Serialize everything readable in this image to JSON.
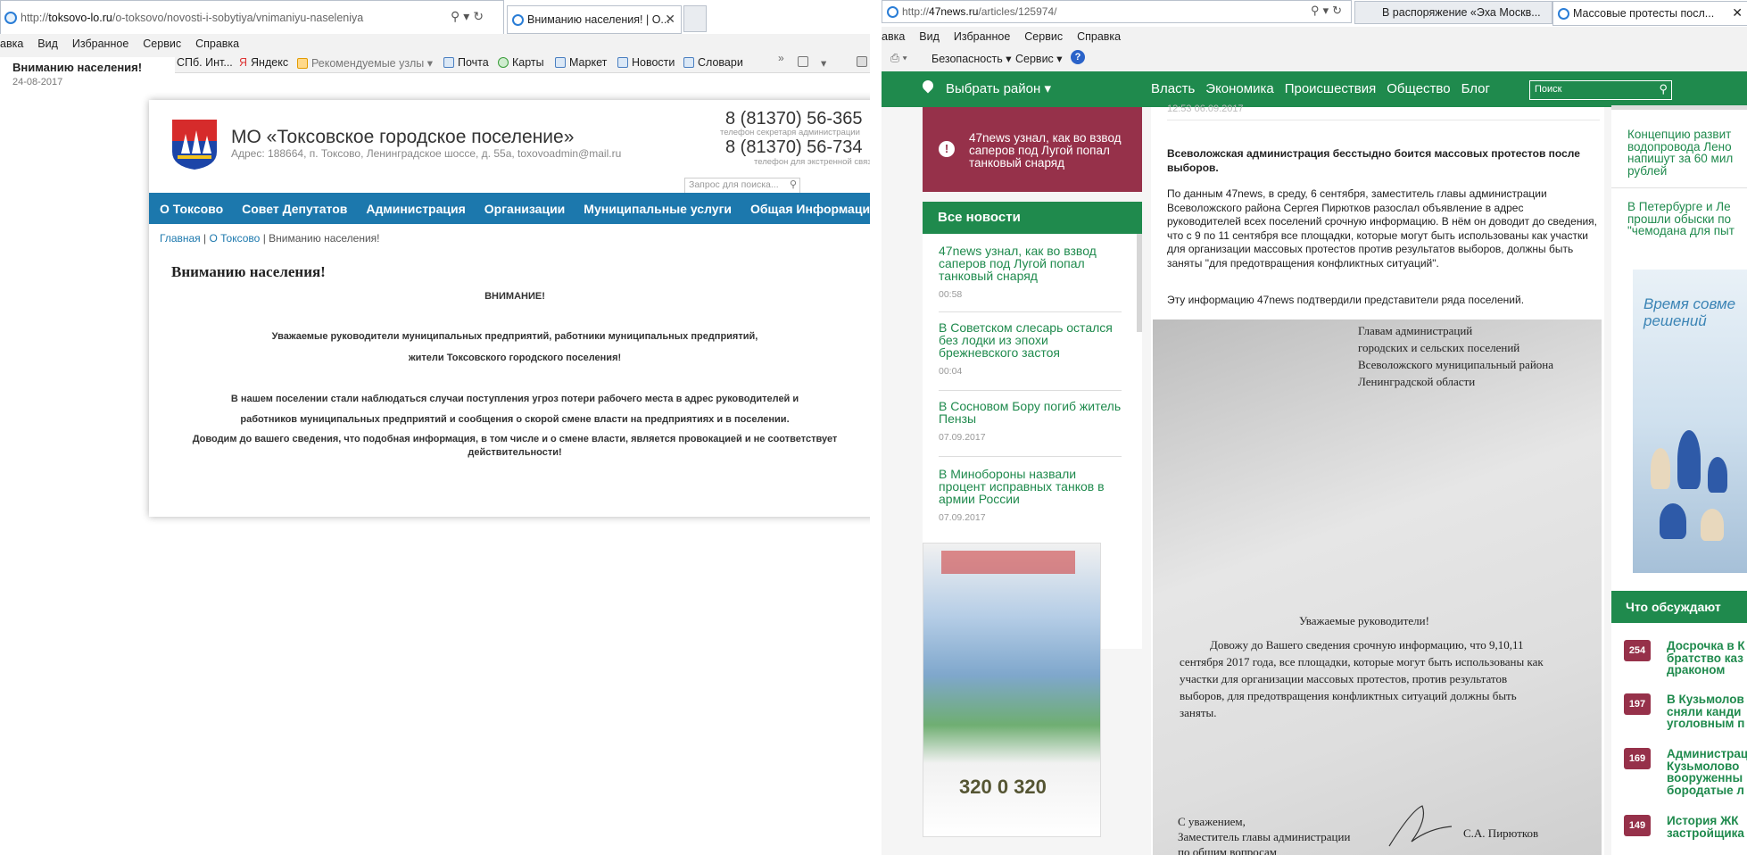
{
  "left": {
    "address_prefix": "http://",
    "address_domain": "toksovo-lo.ru",
    "address_path": "/o-toksovo/novosti-i-sobytiya/vnimaniyu-naseleniya",
    "tab_title": "Вниманию населения! | О...",
    "menu": [
      "авка",
      "Вид",
      "Избранное",
      "Сервис",
      "Справка"
    ],
    "favorites": [
      "СПб. Инт...",
      "Яндекс",
      "Рекомендуемые узлы ▾",
      "Почта",
      "Карты",
      "Маркет",
      "Новости",
      "Словари"
    ],
    "popup_title": "Вниманию населения!",
    "popup_date": "24-08-2017",
    "site_title": "МО «Токсовское городское поселение»",
    "site_address": "Адрес: 188664, п. Токсово, Ленинградское шоссе, д. 55а, toxovoadmin@mail.ru",
    "phone1": "8 (81370) 56-365",
    "phone1_label": "телефон секретаря администрации",
    "phone2": "8 (81370) 56-734",
    "phone2_label": "телефон для экстренной связи",
    "search_placeholder": "Запрос для поиска...",
    "nav": [
      "О Токсово",
      "Совет Депутатов",
      "Администрация",
      "Организации",
      "Муниципальные услуги",
      "Общая Информация"
    ],
    "crumb_home": "Главная",
    "crumb_sep": "|",
    "crumb_section": "О Токсово",
    "crumb_current": "Вниманию населения!",
    "heading": "Вниманию населения!",
    "p_attention": "ВНИМАНИЕ!",
    "p1": "Уважаемые руководители муниципальных предприятий, работники муниципальных предприятий,",
    "p2": "жители Токсовского городского поселения!",
    "p3": "В нашем поселении стали наблюдаться случаи поступления угроз потери рабочего места в адрес руководителей и",
    "p4": "работников муниципальных предприятий и сообщения о  скорой смене  власти на предприятиях и в поселении.",
    "p5": "Доводим до вашего сведения, что подобная  информация, в том числе и о смене власти, является провокацией и не соответствует",
    "p6": "действительности!"
  },
  "right": {
    "address_prefix": "http://",
    "address_domain": "47news.ru",
    "address_path": "/articles/125974/",
    "tab1_title": "В распоряжение «Эха Москв...",
    "tab2_title": "Массовые протесты посл...",
    "menu": [
      "авка",
      "Вид",
      "Избранное",
      "Сервис",
      "Справка"
    ],
    "cmd_safety": "Безопасность ▾",
    "cmd_service": "Сервис ▾",
    "region": "Выбрать район ▾",
    "topnav": [
      "Власть",
      "Экономика",
      "Происшествия",
      "Общество",
      "Блог"
    ],
    "search_placeholder": "Поиск",
    "red_news": "47news узнал, как во взвод саперов под Лугой попал танковый снаряд",
    "all_news": "Все новости",
    "news": [
      {
        "title": "47news узнал, как во взвод саперов под Лугой попал танковый снаряд",
        "time": "00:58"
      },
      {
        "title": "В Советском слесарь остался без лодки из эпохи брежневского застоя",
        "time": "00:04"
      },
      {
        "title": "В Сосновом Бору погиб житель Пензы",
        "time": "07.09.2017"
      },
      {
        "title": "В Минобороны назвали процент исправных танков в армии России",
        "time": "07.09.2017"
      }
    ],
    "ad_text": "320 0 320",
    "article_date": "12:53 06.09.2017",
    "lead": "Всеволожская администрация бесстыдно боится массовых протестов после выборов.",
    "body": "По данным 47news, в среду, 6 сентября, заместитель главы администрации Всеволожского района Сергея Пирютков разослал объявление в адрес руководителей всех поселений срочную информацию. В нём он доводит до сведения, что с 9 по 11 сентября все площадки, которые могут быть использованы как участки для организации массовых протестов против результатов выборов, должны быть заняты \"для предотвращения конфликтных ситуаций\".",
    "confirm": "Эту информацию 47news подтвердили представители ряда поселений.",
    "doc_addr1": "Главам администраций",
    "doc_addr2": "городских и сельских поселений",
    "doc_addr3": "Всеволожского муниципальный района",
    "doc_addr4": "Ленинградской области",
    "doc_greeting": "Уважаемые руководители!",
    "doc_l1": "Довожу до Вашего сведения срочную информацию, что 9,10,11",
    "doc_l2": "сентября 2017 года, все площадки, которые могут быть использованы как",
    "doc_l3": "участки для организации массовых протестов, против результатов",
    "doc_l4": "выборов, для предотвращения конфликтных ситуаций должны быть",
    "doc_l5": "заняты.",
    "doc_sig1": "С уважением,",
    "doc_sig2": "Заместитель главы администрации",
    "doc_sig3": "по общим вопросам",
    "doc_signer": "С.А. Пирютков",
    "rlink1": [
      "Концепцию развит",
      "водопровода Лено",
      "напишут за 60 мил",
      "рублей"
    ],
    "rlink2": [
      "В Петербурге и Ле",
      "прошли обыски по",
      "\"чемодана для пыт"
    ],
    "promo": [
      "Время совме",
      "решений"
    ],
    "discussed": "Что обсуждают",
    "disc": [
      {
        "count": "254",
        "lines": [
          "Досрочка в К",
          "братство каз",
          "драконом"
        ]
      },
      {
        "count": "197",
        "lines": [
          "В Кузьмолов",
          "сняли канди",
          "уголовным п"
        ]
      },
      {
        "count": "169",
        "lines": [
          "Администрац",
          "Кузьмолово",
          "вооруженны",
          "бородатые л"
        ]
      },
      {
        "count": "149",
        "lines": [
          "История ЖК",
          "застройщика"
        ]
      }
    ]
  }
}
